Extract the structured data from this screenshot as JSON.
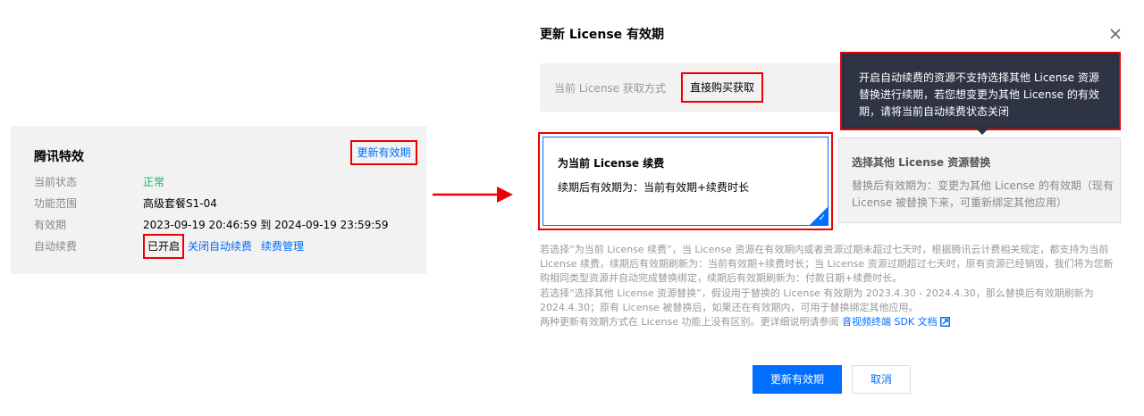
{
  "left": {
    "title": "腾讯特效",
    "update_button": "更新有效期",
    "rows": [
      {
        "key": "当前状态",
        "value": "正常"
      },
      {
        "key": "功能范围",
        "value": "高级套餐S1-04"
      },
      {
        "key": "有效期",
        "value": "2023-09-19 20:46:59 到 2024-09-19 23:59:59"
      },
      {
        "key": "自动续费",
        "value": "已开启",
        "link1": "关闭自动续费",
        "link2": "续费管理"
      }
    ],
    "colors": {
      "status_green": "#0abf5b",
      "link": "#006eff",
      "highlight": "#ee0000"
    }
  },
  "arrow": {
    "icon": "right-arrow-icon",
    "color": "#ee0000"
  },
  "dialog": {
    "title": "更新 License 有效期",
    "close_icon": "close-icon",
    "acquisition": {
      "label": "当前 License 获取方式",
      "value": "直接购买获取"
    },
    "tooltip": "开启自动续费的资源不支持选择其他 License 资源替换进行续期，若您想变更为其他 License 的有效期，请将当前自动续费状态关闭",
    "option_renew": {
      "title": "为当前 License 续费",
      "desc": "续期后有效期为：当前有效期+续费时长",
      "selected": true
    },
    "option_replace": {
      "title": "选择其他 License 资源替换",
      "desc": "替换后有效期为：变更为其他 License 的有效期（现有 License 被替换下来，可重新绑定其他应用）"
    },
    "notes": {
      "line1": "若选择“为当前 License 续费”，当 License 资源在有效期内或者资源过期未超过七天时，根据腾讯云计费相关规定，都支持为当前 License 续费，续期后有效期刷新为：当前有效期+续费时长；当 License 资源过期超过七天时，原有资源已经销毁，我们将为您新购相同类型资源并自动完成替换绑定，续期后有效期刷新为：付款日期+续费时长。",
      "line2": "若选择“选择其他 License 资源替换”，假设用于替换的 License 有效期为 2023.4.30 - 2024.4.30，那么替换后有效期刷新为 2024.4.30；原有 License 被替换后，如果还在有效期内，可用于替换绑定其他应用。",
      "line3": "两种更新有效期方式在 License 功能上没有区别。更详细说明请参阅",
      "link": "音视频终端 SDK 文档"
    },
    "confirm_button": "更新有效期",
    "cancel_button": "取消"
  }
}
